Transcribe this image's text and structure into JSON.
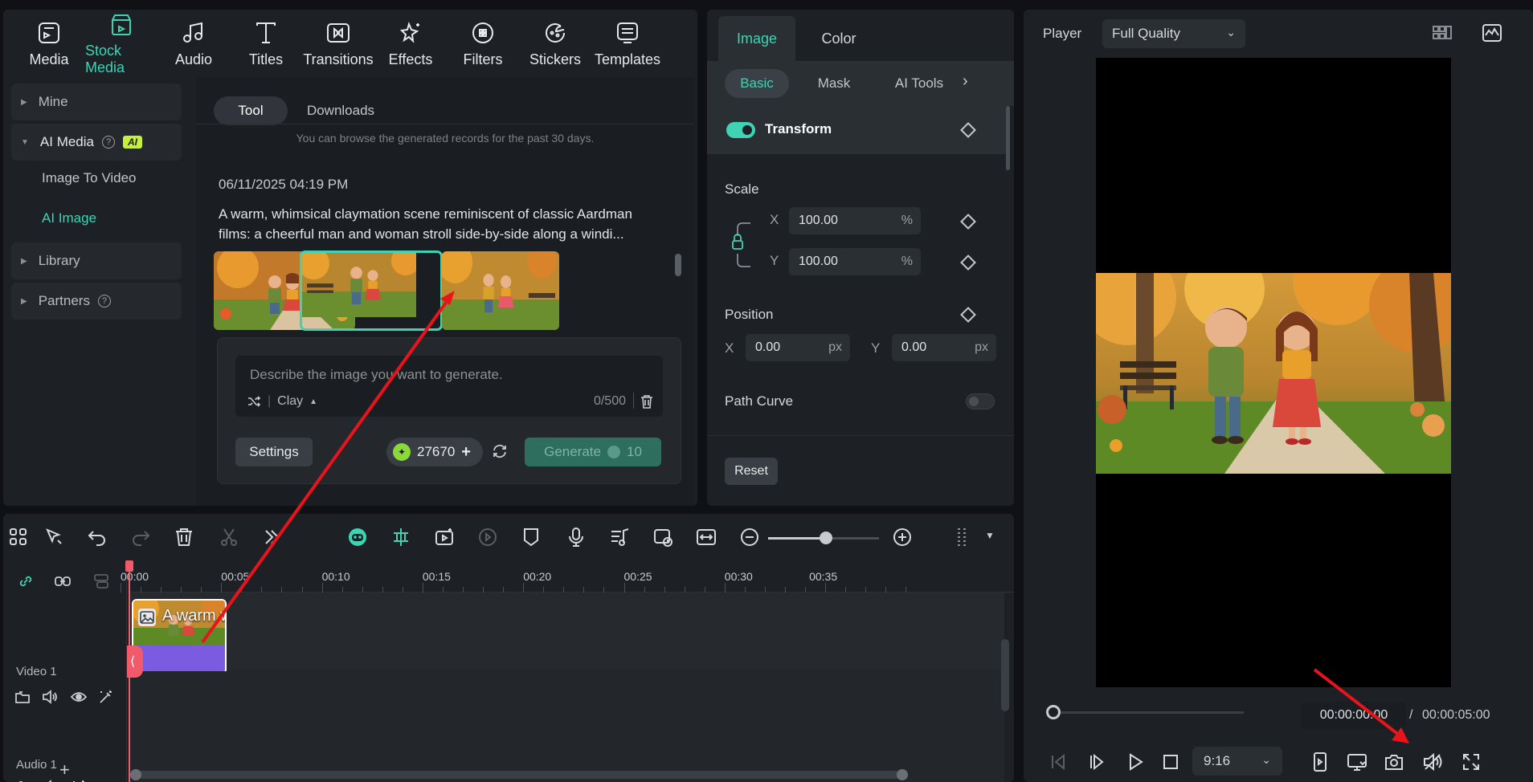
{
  "media_toolbar": {
    "tabs": [
      {
        "label": "Media",
        "icon": "media-icon"
      },
      {
        "label": "Stock Media",
        "icon": "stock-media-icon"
      },
      {
        "label": "Audio",
        "icon": "music-note-icon"
      },
      {
        "label": "Titles",
        "icon": "text-t-icon"
      },
      {
        "label": "Transitions",
        "icon": "transitions-icon"
      },
      {
        "label": "Effects",
        "icon": "effects-sparkle-icon"
      },
      {
        "label": "Filters",
        "icon": "filters-icon"
      },
      {
        "label": "Stickers",
        "icon": "sticker-icon"
      },
      {
        "label": "Templates",
        "icon": "templates-icon"
      }
    ],
    "active_index": 1
  },
  "sidebar": {
    "mine": "Mine",
    "ai_media": "AI Media",
    "ai_badge": "AI",
    "image_to_video": "Image To Video",
    "ai_image": "AI Image",
    "library": "Library",
    "partners": "Partners"
  },
  "content": {
    "tab_tool": "Tool",
    "tab_downloads": "Downloads",
    "info_note": "You can browse the generated records for the past 30 days.",
    "record_date": "06/11/2025 04:19 PM",
    "record_desc_line1": "A warm, whimsical claymation scene reminiscent of classic Aardman",
    "record_desc_line2": "films: a cheerful man and woman stroll side-by-side along a windi...",
    "prompt_placeholder": "Describe the image you want to generate.",
    "style_name": "Clay",
    "char_count": "0/500",
    "settings_label": "Settings",
    "credits": "27670",
    "generate_label": "Generate",
    "generate_cost": "10"
  },
  "properties": {
    "tab_image": "Image",
    "tab_color": "Color",
    "sub_basic": "Basic",
    "sub_mask": "Mask",
    "sub_ai_tools": "AI Tools",
    "transform": "Transform",
    "scale": "Scale",
    "scale_x_label": "X",
    "scale_x": "100.00",
    "scale_y_label": "Y",
    "scale_y": "100.00",
    "percent": "%",
    "position": "Position",
    "pos_x_label": "X",
    "pos_x": "0.00",
    "pos_y_label": "Y",
    "pos_y": "0.00",
    "px": "px",
    "path_curve": "Path Curve",
    "reset_label": "Reset"
  },
  "player": {
    "label": "Player",
    "quality": "Full Quality",
    "time_current": "00:00:00:00",
    "time_sep": "/",
    "time_total": "00:00:05:00",
    "ratio": "9:16",
    "progress": 0
  },
  "timeline": {
    "ticks": [
      "00:00",
      "00:05",
      "00:10",
      "00:15",
      "00:20",
      "00:25",
      "00:30",
      "00:35"
    ],
    "video_track": "Video 1",
    "audio_track": "Audio 1",
    "clip_label": "A warm wh",
    "add_track": "+",
    "zoom_level": 0.52
  },
  "colors": {
    "accent": "#3fd3b4",
    "annotation": "#e8141c",
    "playhead": "#f05a6a",
    "clip": "#7b5be0"
  }
}
